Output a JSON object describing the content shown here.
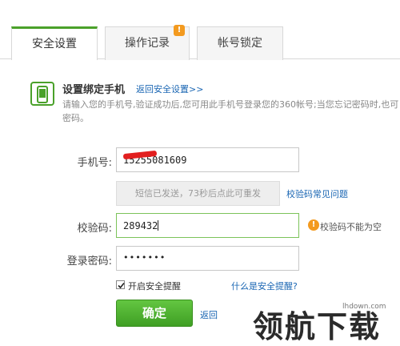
{
  "tabs": [
    {
      "label": "安全设置",
      "active": true
    },
    {
      "label": "操作记录",
      "badge": "!"
    },
    {
      "label": "帐号锁定"
    }
  ],
  "section": {
    "title": "设置绑定手机",
    "back_link": "返回安全设置>>",
    "description_line1": "请输入您的手机号,验证成功后,您可用此手机号登录您的360帐号;当您忘记密码时,也可",
    "description_line2": "密码。"
  },
  "form": {
    "phone_label": "手机号:",
    "phone_value": "15255081609",
    "sms_status": "短信已发送，73秒后点此可重发",
    "faq_link": "校验码常见问题",
    "code_label": "校验码:",
    "code_value": "289432",
    "code_error": "校验码不能为空",
    "password_label": "登录密码:",
    "password_value": "•••••••",
    "safety_checkbox_label": "开启安全提醒",
    "safety_help_link": "什么是安全提醒?",
    "confirm_label": "确定",
    "back_label": "返回"
  },
  "watermark": {
    "url": "lhdown.com",
    "logo": "领航下载"
  },
  "colors": {
    "accent_green": "#4aa12a",
    "link_blue": "#1a66b3",
    "warning_orange": "#f39a1f"
  }
}
